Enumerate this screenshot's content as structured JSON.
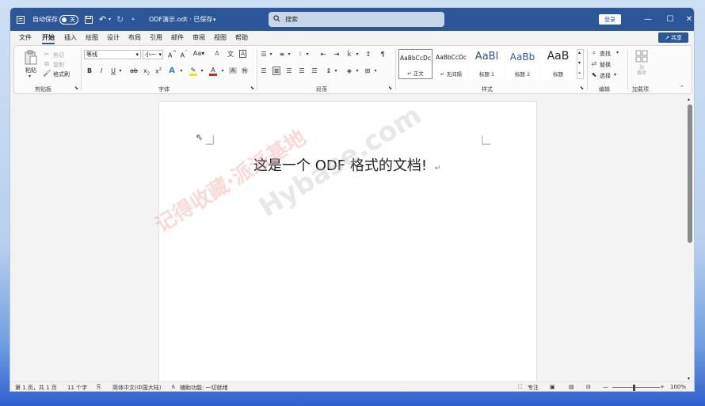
{
  "titlebar": {
    "autosave_label": "自动保存",
    "autosave_state": "关",
    "doc_title": "ODF演示.odt · 已保存",
    "search_placeholder": "搜索",
    "login": "登录",
    "minimize": "—",
    "restore": "☐",
    "close": "✕"
  },
  "menu": {
    "tabs": [
      "文件",
      "开始",
      "插入",
      "绘图",
      "设计",
      "布局",
      "引用",
      "邮件",
      "审阅",
      "视图",
      "帮助"
    ],
    "share": "共享"
  },
  "ribbon": {
    "clipboard": {
      "label": "剪贴板",
      "paste": "粘贴",
      "cut": "剪切",
      "copy": "复制",
      "format_painter": "格式刷"
    },
    "font": {
      "label": "字体",
      "font_name": "等线",
      "font_size": "小一"
    },
    "paragraph": {
      "label": "段落"
    },
    "styles": {
      "label": "样式",
      "items": [
        {
          "preview": "AaBbCcDc",
          "name": "↵ 正文"
        },
        {
          "preview": "AaBbCcDc",
          "name": "↵ 无间隔"
        },
        {
          "preview": "AaBl",
          "name": "标题 1"
        },
        {
          "preview": "AaBb",
          "name": "标题 2"
        },
        {
          "preview": "AaB",
          "name": "标题"
        }
      ]
    },
    "editing": {
      "label": "编辑",
      "find": "查找",
      "replace": "替换",
      "select": "选择"
    },
    "addins": {
      "label": "加载项",
      "button": "加\n载项"
    }
  },
  "document": {
    "text": "这是一个 ODF 格式的文档!",
    "para_mark": "↵"
  },
  "watermark": {
    "text1": "记得收藏·派派基地",
    "text2": "Hybase.com"
  },
  "statusbar": {
    "page": "第 1 页，共 1 页",
    "words": "11 个字",
    "language": "简体中文(中国大陆)",
    "accessibility": "辅助功能: 一切就绪",
    "focus": "专注",
    "zoom": "100%"
  }
}
